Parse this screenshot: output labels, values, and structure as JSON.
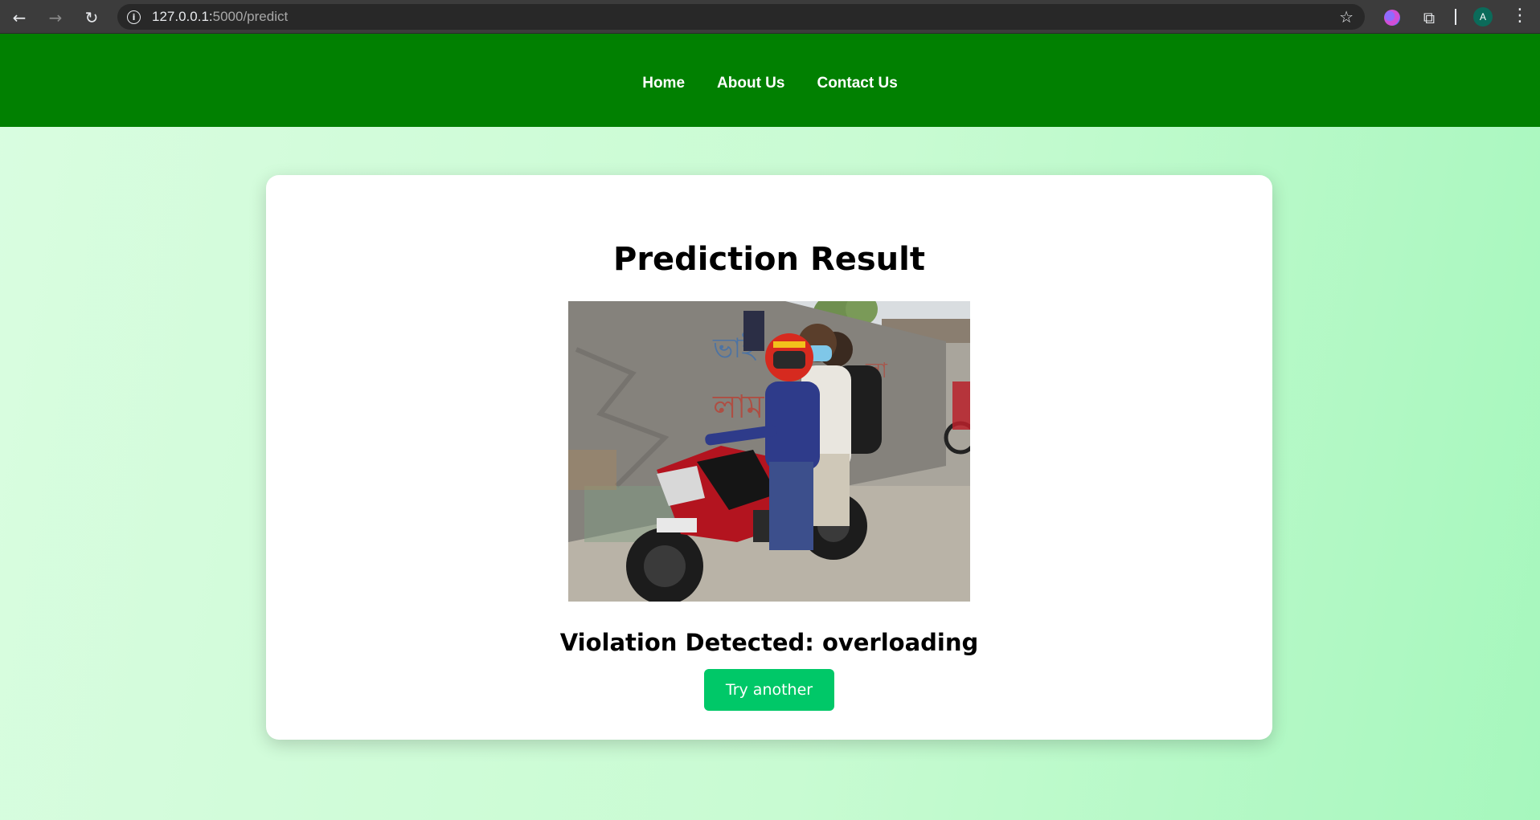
{
  "browser": {
    "url_host": "127.0.0.1:",
    "url_path": "5000/predict",
    "profile_initial": "A"
  },
  "nav": {
    "links": [
      "Home",
      "About Us",
      "Contact Us"
    ]
  },
  "result": {
    "title": "Prediction Result",
    "image_alt": "Three riders on a red motorcycle in an alley",
    "violation_text": "Violation Detected: overloading",
    "button_label": "Try another"
  },
  "colors": {
    "nav_bg": "#018001",
    "button_bg": "#00c868",
    "page_bg": "#c8fbd2"
  }
}
